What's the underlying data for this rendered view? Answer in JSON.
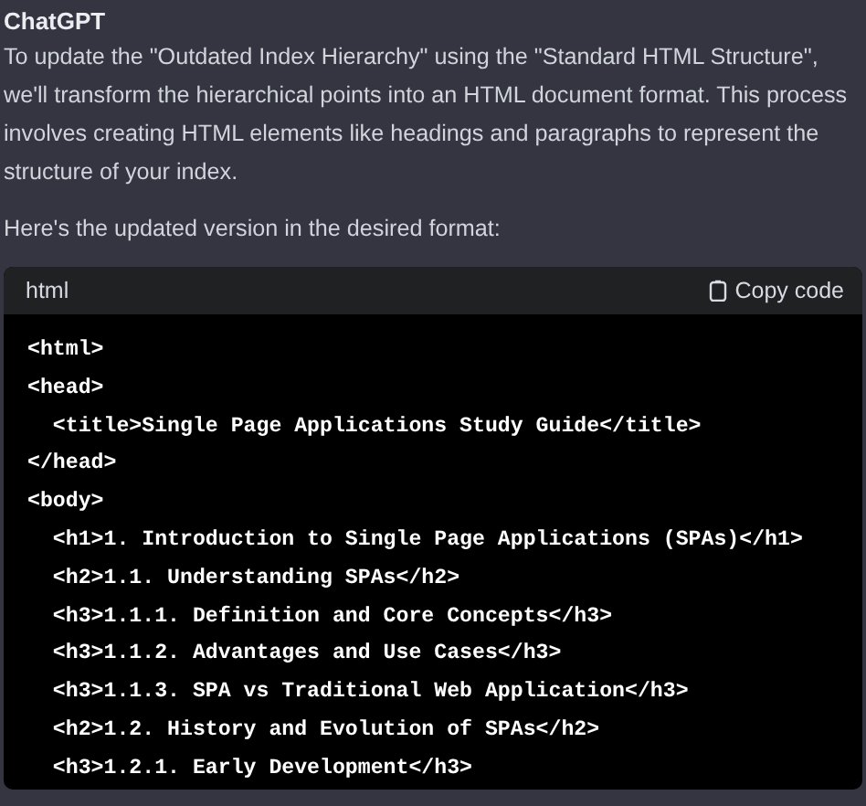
{
  "author": "ChatGPT",
  "paragraphs": [
    "To update the \"Outdated Index Hierarchy\" using the \"Standard HTML Structure\", we'll transform the hierarchical points into an HTML document format. This process involves creating HTML elements like headings and paragraphs to represent the structure of your index.",
    "Here's the updated version in the desired format:"
  ],
  "code_block": {
    "language": "html",
    "copy_label": "Copy code",
    "lines": [
      "<html>",
      "<head>",
      "  <title>Single Page Applications Study Guide</title>",
      "</head>",
      "<body>",
      "  <h1>1. Introduction to Single Page Applications (SPAs)</h1>",
      "  <h2>1.1. Understanding SPAs</h2>",
      "  <h3>1.1.1. Definition and Core Concepts</h3>",
      "  <h3>1.1.2. Advantages and Use Cases</h3>",
      "  <h3>1.1.3. SPA vs Traditional Web Application</h3>",
      "  <h2>1.2. History and Evolution of SPAs</h2>",
      "  <h3>1.2.1. Early Development</h3>"
    ]
  }
}
